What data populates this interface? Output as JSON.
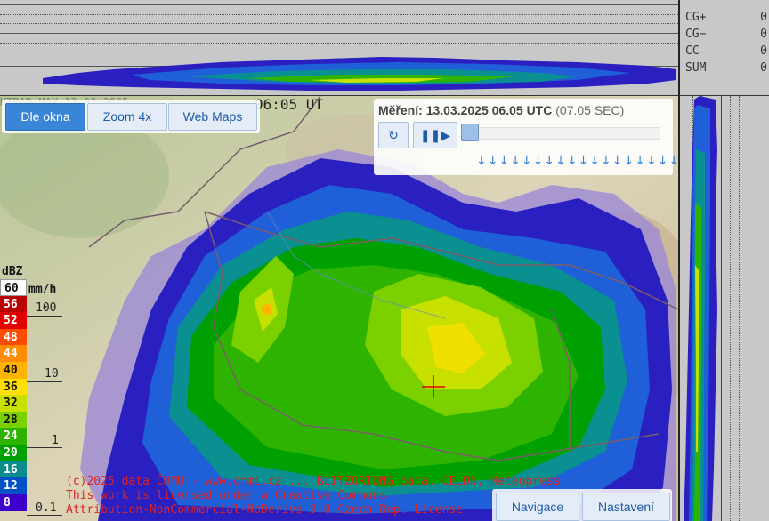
{
  "view_buttons": [
    {
      "label": "Dle okna",
      "active": true
    },
    {
      "label": "Zoom 4x",
      "active": false
    },
    {
      "label": "Web Maps",
      "active": false
    }
  ],
  "map_time": "06:05 UT",
  "player": {
    "label": "Měření:",
    "datetime": "13.03.2025 06.05 UTC",
    "seconds": "(07.05 SEC)",
    "refresh_icon": "refresh-icon",
    "pause_icon": "pause-play-icon",
    "frame_ticks": "↓↓↓↓↓↓↓↓↓↓↓↓↓↓↓↓↓↓"
  },
  "lightning": [
    {
      "label": "CG+",
      "value": "0"
    },
    {
      "label": "CG−",
      "value": "0"
    },
    {
      "label": "CC",
      "value": "0"
    },
    {
      "label": "SUM",
      "value": "0"
    }
  ],
  "legend": {
    "title": "dBZ",
    "unit": "mm/h",
    "levels": [
      {
        "dbz": "60",
        "color": "#ffffff"
      },
      {
        "dbz": "56",
        "color": "#b80000"
      },
      {
        "dbz": "52",
        "color": "#e30000"
      },
      {
        "dbz": "48",
        "color": "#ff4a00"
      },
      {
        "dbz": "44",
        "color": "#ff8c00"
      },
      {
        "dbz": "40",
        "color": "#ffb400"
      },
      {
        "dbz": "36",
        "color": "#ffe000"
      },
      {
        "dbz": "32",
        "color": "#c8e000"
      },
      {
        "dbz": "28",
        "color": "#7bd000"
      },
      {
        "dbz": "24",
        "color": "#2eb400"
      },
      {
        "dbz": "20",
        "color": "#00a000"
      },
      {
        "dbz": "16",
        "color": "#0a8c8c"
      },
      {
        "dbz": "12",
        "color": "#0050c8"
      },
      {
        "dbz": "8",
        "color": "#3c00c8"
      }
    ],
    "rates": [
      "100",
      "10",
      "1",
      "0.1"
    ]
  },
  "license": {
    "line1": "(c)2025 data ČHMÚ  -  www.chmi.cz ... BLITZORTUNG data, CELDN, Meteopress",
    "line2": "This work is licensed under a Creative Commons",
    "line3": "Attribution-NonCommercial-NoDerivs 3.0 Czech Rep. License"
  },
  "bottom_buttons": {
    "navigation": "Navigace",
    "settings": "Nastavení"
  }
}
